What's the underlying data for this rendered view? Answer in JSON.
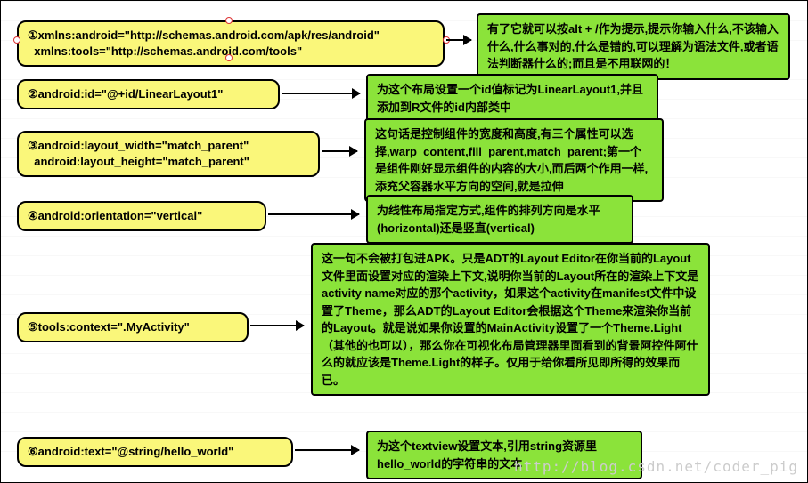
{
  "nodes": {
    "n1": {
      "label": "①xmlns:android=\"http://schemas.android.com/apk/res/android\"\n  xmlns:tools=\"http://schemas.android.com/tools\"",
      "desc": "有了它就可以按alt + /作为提示,提示你输入什么,不该输入什么,什么事对的,什么是错的,可以理解为语法文件,或者语法判断器什么的;而且是不用联网的！"
    },
    "n2": {
      "label": "②android:id=\"@+id/LinearLayout1\"",
      "desc": "为这个布局设置一个id值标记为LinearLayout1,并且添加到R文件的id内部类中"
    },
    "n3": {
      "label": "③android:layout_width=\"match_parent\"\n  android:layout_height=\"match_parent\"",
      "desc": "这句话是控制组件的宽度和高度,有三个属性可以选择,warp_content,fill_parent,match_parent;第一个是组件刚好显示组件的内容的大小,而后两个作用一样,添充父容器水平方向的空间,就是拉伸"
    },
    "n4": {
      "label": "④android:orientation=\"vertical\"",
      "desc": "为线性布局指定方式,组件的排列方向是水平(horizontal)还是竖直(vertical)"
    },
    "n5": {
      "label": "⑤tools:context=\".MyActivity\"",
      "desc": "这一句不会被打包进APK。只是ADT的Layout Editor在你当前的Layout文件里面设置对应的渲染上下文,说明你当前的Layout所在的渲染上下文是activity name对应的那个activity，如果这个activity在manifest文件中设置了Theme，那么ADT的Layout Editor会根据这个Theme来渲染你当前的Layout。就是说如果你设置的MainActivity设置了一个Theme.Light（其他的也可以），那么你在可视化布局管理器里面看到的背景阿控件阿什么的就应该是Theme.Light的样子。仅用于给你看所见即所得的效果而已。"
    },
    "n6": {
      "label": "⑥android:text=\"@string/hello_world\"",
      "desc": "为这个textview设置文本,引用string资源里hello_world的字符串的文本"
    }
  },
  "watermark": "http://blog.csdn.net/coder_pig"
}
